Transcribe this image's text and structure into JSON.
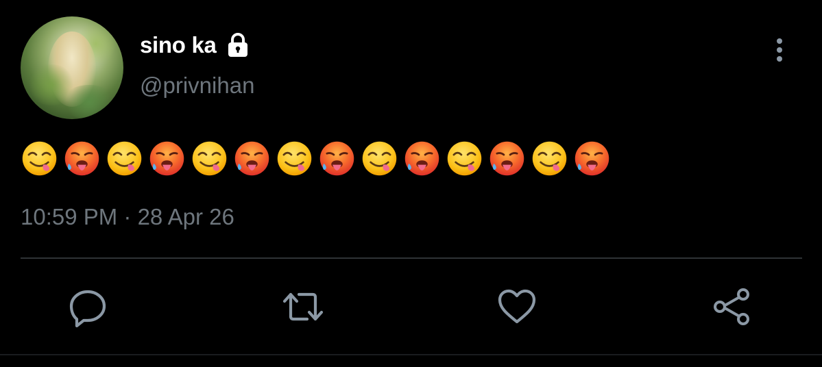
{
  "tweet": {
    "display_name": "sino ka",
    "handle": "@privnihan",
    "protected_icon": "lock-icon",
    "more_icon": "more-vertical-icon",
    "body_emojis": [
      "face-savoring-food",
      "hot-face",
      "face-savoring-food",
      "hot-face",
      "face-savoring-food",
      "hot-face",
      "face-savoring-food",
      "hot-face",
      "face-savoring-food",
      "hot-face",
      "face-savoring-food",
      "hot-face",
      "face-savoring-food",
      "hot-face"
    ],
    "timestamp": "10:59 PM · 28 Apr 26"
  },
  "actions": [
    {
      "name": "reply",
      "icon": "reply-icon"
    },
    {
      "name": "retweet",
      "icon": "retweet-icon"
    },
    {
      "name": "like",
      "icon": "heart-icon"
    },
    {
      "name": "share",
      "icon": "share-icon"
    }
  ],
  "colors": {
    "background": "#000000",
    "primary_text": "#ffffff",
    "secondary_text": "#6e767d",
    "divider": "#2f3336",
    "icon": "#8b98a5"
  }
}
